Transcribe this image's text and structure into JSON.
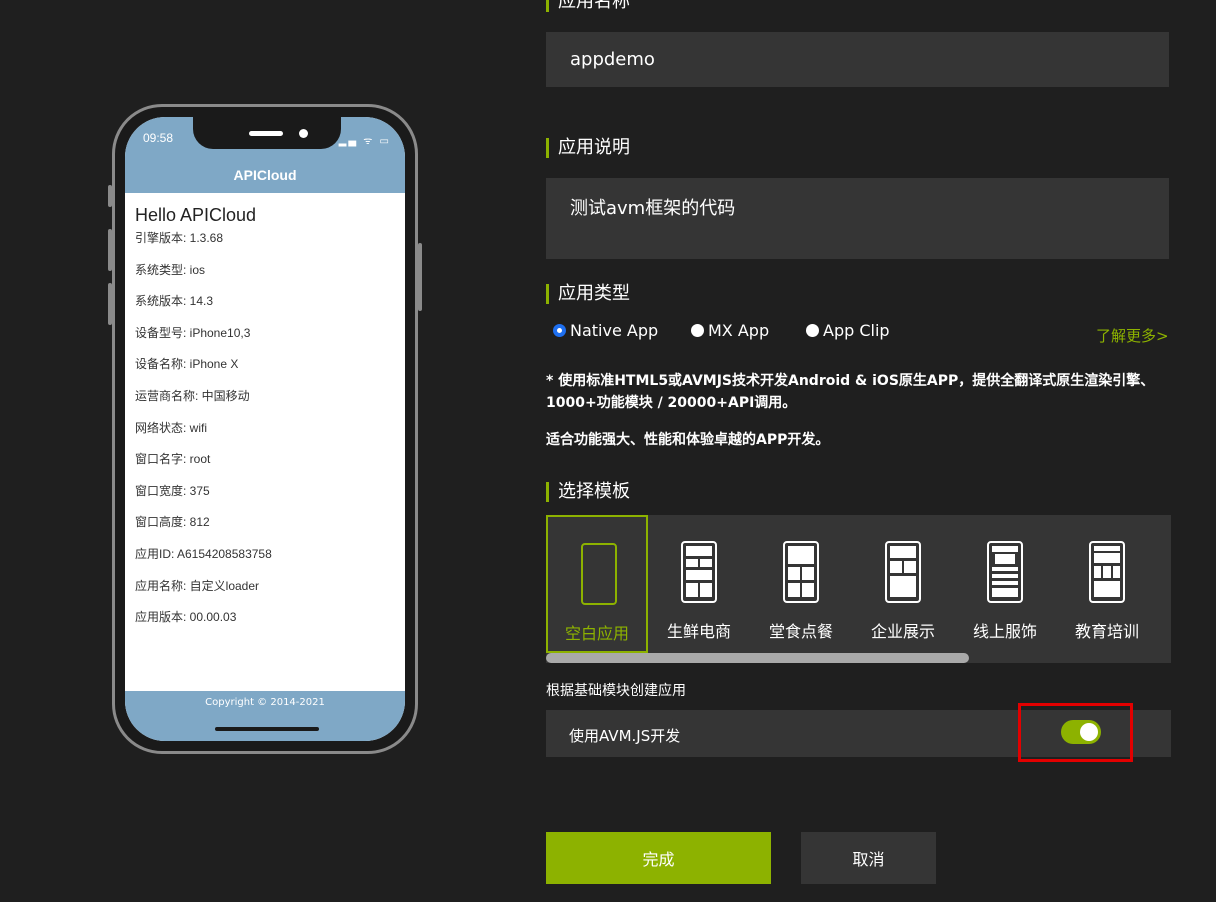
{
  "phone": {
    "time": "09:58",
    "status_icons": "▂▄ ᯤ ▭",
    "title": "APICloud",
    "hello": "Hello APICloud",
    "info": [
      "引擎版本: 1.3.68",
      "系统类型: ios",
      "系统版本: 14.3",
      "设备型号: iPhone10,3",
      "设备名称: iPhone X",
      "运营商名称: 中国移动",
      "网络状态: wifi",
      "窗口名字: root",
      "窗口宽度: 375",
      "窗口高度: 812",
      "应用ID: A6154208583758",
      "应用名称: 自定义loader",
      "应用版本: 00.00.03"
    ],
    "copyright": "Copyright © 2014-2021"
  },
  "form": {
    "app_name_label": "应用名称",
    "app_name_value": "appdemo",
    "app_desc_label": "应用说明",
    "app_desc_value": "测试avm框架的代码",
    "app_type_label": "应用类型",
    "app_types": [
      {
        "label": "Native App",
        "selected": true
      },
      {
        "label": "MX App",
        "selected": false
      },
      {
        "label": "App Clip",
        "selected": false
      }
    ],
    "learn_more": "了解更多>",
    "desc_line1": "* 使用标准HTML5或AVMJS技术开发Android & iOS原生APP，提供全翻译式原生渲染引擎、1000+功能模块 / 20000+API调用。",
    "desc_line2": "适合功能强大、性能和体验卓越的APP开发。",
    "template_label": "选择模板",
    "templates": [
      {
        "label": "空白应用",
        "icon": "blank-template-icon"
      },
      {
        "label": "生鲜电商",
        "icon": "fresh-ecommerce-template-icon"
      },
      {
        "label": "堂食点餐",
        "icon": "dine-in-order-template-icon"
      },
      {
        "label": "企业展示",
        "icon": "enterprise-showcase-template-icon"
      },
      {
        "label": "线上服饰",
        "icon": "online-apparel-template-icon"
      },
      {
        "label": "教育培训",
        "icon": "education-training-template-icon"
      }
    ],
    "subnote": "根据基础模块创建应用",
    "avm_label": "使用AVM.JS开发",
    "avm_enabled": true,
    "done": "完成",
    "cancel": "取消"
  },
  "colors": {
    "accent": "#8db200",
    "panel": "#353535",
    "background": "#1f1f1f",
    "highlight": "#e30000"
  }
}
